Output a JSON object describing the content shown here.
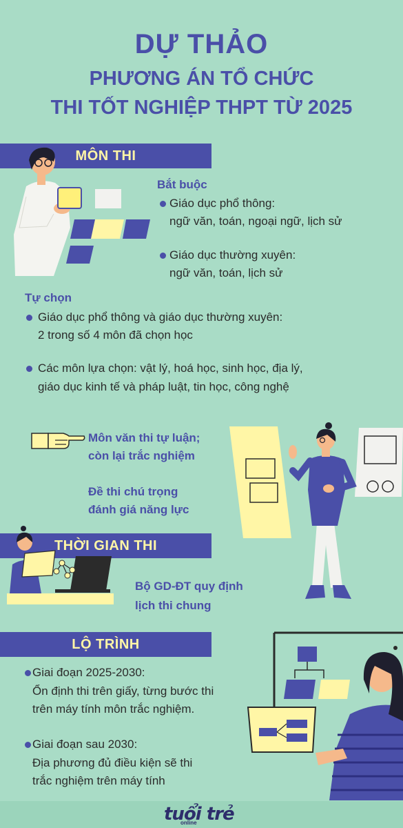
{
  "title": {
    "line1": "DỰ THẢO",
    "line2": "PHƯƠNG ÁN TỔ CHỨC",
    "line3": "THI TỐT NGHIỆP THPT TỪ 2025"
  },
  "mon_thi": {
    "heading": "MÔN THI",
    "bat_buoc": {
      "label": "Bắt buộc",
      "items": [
        {
          "title": "Giáo dục phổ thông:",
          "detail": "ngữ văn, toán, ngoại ngữ, lịch sử"
        },
        {
          "title": "Giáo dục thường xuyên:",
          "detail": "ngữ văn, toán, lịch sử"
        }
      ]
    },
    "tu_chon": {
      "label": "Tự chọn",
      "items": [
        {
          "line1": "Giáo dục phổ thông và giáo dục thường xuyên:",
          "line2": "2 trong số 4 môn đã chọn học"
        },
        {
          "line1": "Các môn lựa chọn: vật lý, hoá học, sinh học, địa lý,",
          "line2": "giáo dục kinh tế và pháp luật, tin học, công nghệ"
        }
      ]
    },
    "note1": {
      "line1": "Môn văn thi tự luận;",
      "line2": "còn lại trắc nghiệm"
    },
    "note2": {
      "line1": "Đề thi chú trọng",
      "line2": "đánh giá năng lực"
    }
  },
  "thoi_gian": {
    "heading": "THỜI GIAN THI",
    "text": {
      "line1": "Bộ GD-ĐT quy định",
      "line2": "lịch thi chung"
    }
  },
  "lo_trinh": {
    "heading": "LỘ TRÌNH",
    "items": [
      {
        "title": "Giai đoạn 2025-2030:",
        "line1": "Ổn định thi trên giấy, từng bước thi",
        "line2": "trên máy tính môn trắc nghiệm."
      },
      {
        "title": "Giai đoạn sau 2030:",
        "line1": "Địa phương đủ điều kiện sẽ thi",
        "line2": "trắc nghiệm trên máy tính"
      }
    ]
  },
  "footer": {
    "logo": "tuổi trẻ",
    "logo_sub": "online"
  },
  "colors": {
    "background": "#a9dcc6",
    "primary": "#4a4fa8",
    "accent": "#fff6a6"
  }
}
